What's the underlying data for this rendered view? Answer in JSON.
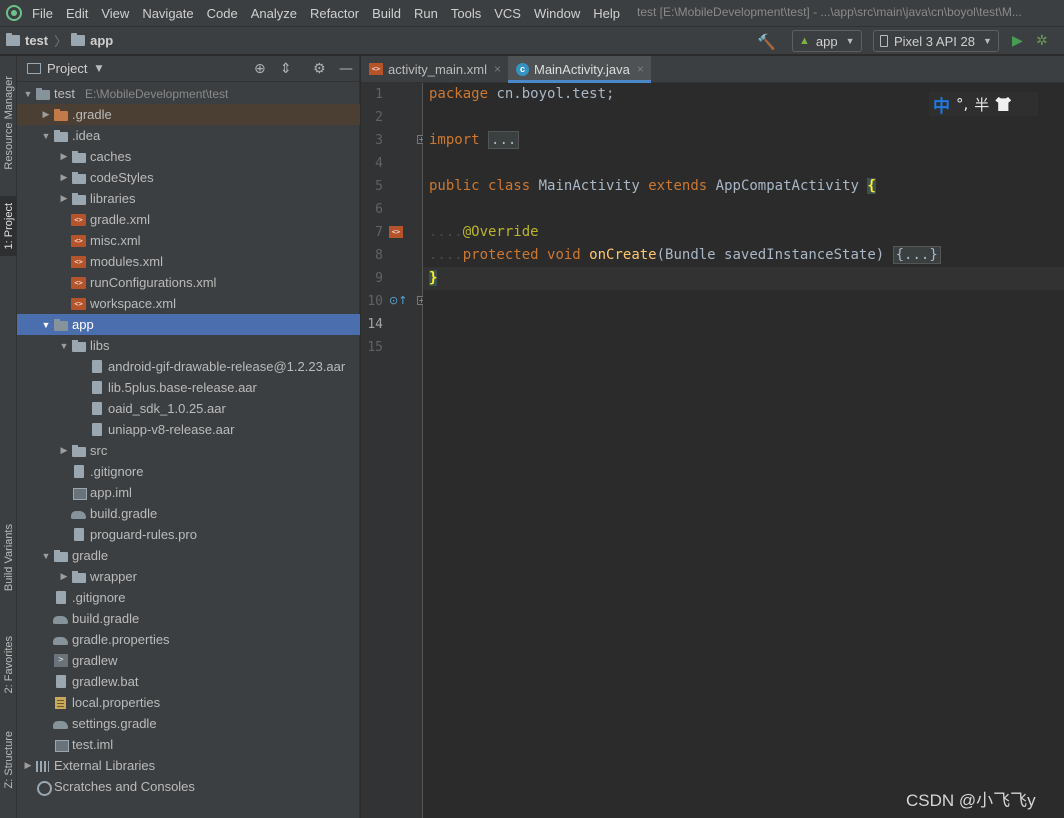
{
  "menubar": {
    "items": [
      "File",
      "Edit",
      "View",
      "Navigate",
      "Code",
      "Analyze",
      "Refactor",
      "Build",
      "Run",
      "Tools",
      "VCS",
      "Window",
      "Help"
    ],
    "window_title": "test [E:\\MobileDevelopment\\test] - ...\\app\\src\\main\\java\\cn\\boyol\\test\\M..."
  },
  "navbar": {
    "crumb_project": "test",
    "crumb_module": "app",
    "run_config": "app",
    "device": "Pixel 3 API 28"
  },
  "left_stripe": {
    "resource_manager": "Resource Manager",
    "project": "1: Project",
    "build_variants": "Build Variants",
    "favorites": "2: Favorites",
    "structure": "Z: Structure"
  },
  "project_panel": {
    "title": "Project",
    "tree": [
      {
        "label": "test",
        "path": "E:\\MobileDevelopment\\test",
        "icon": "module-folder-icon",
        "arrow": "down"
      },
      {
        "label": ".gradle",
        "icon": "orange-folder-icon",
        "arrow": "right"
      },
      {
        "label": ".idea",
        "icon": "folder-icon",
        "arrow": "down"
      },
      {
        "label": "caches",
        "icon": "folder-icon",
        "arrow": "right"
      },
      {
        "label": "codeStyles",
        "icon": "folder-icon",
        "arrow": "right"
      },
      {
        "label": "libraries",
        "icon": "folder-icon",
        "arrow": "right"
      },
      {
        "label": "gradle.xml",
        "icon": "xml-file-icon"
      },
      {
        "label": "misc.xml",
        "icon": "xml-file-icon"
      },
      {
        "label": "modules.xml",
        "icon": "xml-file-icon"
      },
      {
        "label": "runConfigurations.xml",
        "icon": "xml-file-icon"
      },
      {
        "label": "workspace.xml",
        "icon": "xml-file-icon"
      },
      {
        "label": "app",
        "icon": "module-folder-icon",
        "arrow": "down"
      },
      {
        "label": "libs",
        "icon": "folder-icon",
        "arrow": "down"
      },
      {
        "label": "android-gif-drawable-release@1.2.23.aar",
        "icon": "aar-file-icon"
      },
      {
        "label": "lib.5plus.base-release.aar",
        "icon": "aar-file-icon"
      },
      {
        "label": "oaid_sdk_1.0.25.aar",
        "icon": "aar-file-icon"
      },
      {
        "label": "uniapp-v8-release.aar",
        "icon": "aar-file-icon"
      },
      {
        "label": "src",
        "icon": "folder-icon",
        "arrow": "right"
      },
      {
        "label": ".gitignore",
        "icon": "gitignore-file-icon"
      },
      {
        "label": "app.iml",
        "icon": "iml-file-icon"
      },
      {
        "label": "build.gradle",
        "icon": "gradle-file-icon"
      },
      {
        "label": "proguard-rules.pro",
        "icon": "text-file-icon"
      },
      {
        "label": "gradle",
        "icon": "folder-icon",
        "arrow": "down"
      },
      {
        "label": "wrapper",
        "icon": "folder-icon",
        "arrow": "right"
      },
      {
        "label": ".gitignore",
        "icon": "gitignore-file-icon"
      },
      {
        "label": "build.gradle",
        "icon": "gradle-file-icon"
      },
      {
        "label": "gradle.properties",
        "icon": "gradle-file-icon"
      },
      {
        "label": "gradlew",
        "icon": "terminal-file-icon"
      },
      {
        "label": "gradlew.bat",
        "icon": "text-file-icon"
      },
      {
        "label": "local.properties",
        "icon": "properties-file-icon"
      },
      {
        "label": "settings.gradle",
        "icon": "gradle-file-icon"
      },
      {
        "label": "test.iml",
        "icon": "iml-file-icon"
      },
      {
        "label": "External Libraries",
        "icon": "libraries-icon",
        "arrow": "right"
      },
      {
        "label": "Scratches and Consoles",
        "icon": "scratches-icon"
      }
    ]
  },
  "editor": {
    "tabs": [
      {
        "label": "activity_main.xml",
        "icon": "xml-file-icon",
        "active": false
      },
      {
        "label": "MainActivity.java",
        "icon": "java-class-icon",
        "active": true
      }
    ],
    "line_numbers": [
      "1",
      "2",
      "3",
      "4",
      "5",
      "6",
      "7",
      "8",
      "9",
      "10",
      "14",
      "15"
    ],
    "code": {
      "package_kw": "package",
      "package_name": " cn.boyol.test;",
      "import_kw": "import",
      "import_fold": "...",
      "public_kw": "public",
      "class_kw": "class",
      "class_name": "MainActivity",
      "extends_kw": "extends",
      "parent": "AppCompatActivity",
      "open_brace": "{",
      "indent": "....",
      "annotation": "@Override",
      "protected_kw": "protected",
      "void_kw": "void",
      "method": "onCreate",
      "params": "(Bundle savedInstanceState)",
      "method_fold": "{...}",
      "close_brace": "}"
    }
  },
  "ime": {
    "mode": "中",
    "punct": "°,",
    "width": "半"
  },
  "watermark": "CSDN @小飞飞y",
  "colors": {
    "selection": "#4b6eaf",
    "keyword": "#cc7832",
    "annotation": "#bbb529",
    "method": "#ffc66d"
  }
}
